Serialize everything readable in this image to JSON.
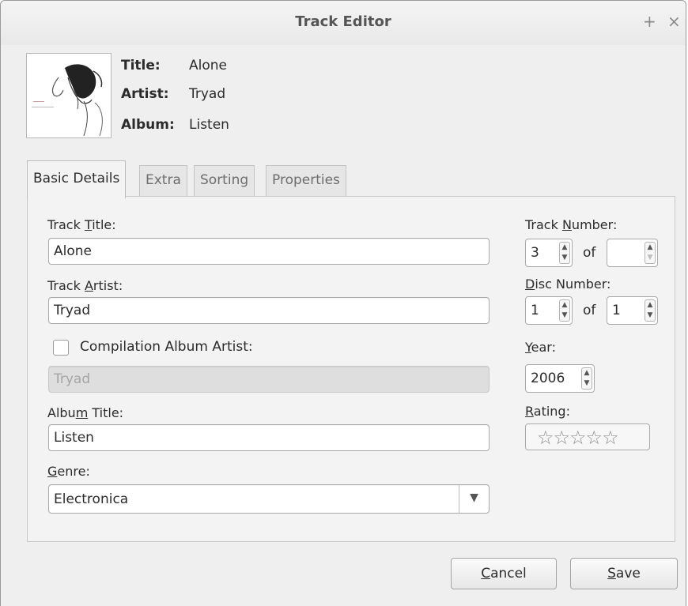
{
  "window": {
    "title": "Track Editor",
    "add_glyph": "+",
    "close_glyph": "×"
  },
  "header": {
    "cover_icon": "album-cover",
    "title_key": "Title:",
    "title_val": "Alone",
    "artist_key": "Artist:",
    "artist_val": "Tryad",
    "album_key": "Album:",
    "album_val": "Listen"
  },
  "tabs": [
    {
      "label": "Basic Details",
      "active": true
    },
    {
      "label": "Extra",
      "active": false
    },
    {
      "label": "Sorting",
      "active": false
    },
    {
      "label": "Properties",
      "active": false
    }
  ],
  "form": {
    "track_title_label_pre": "Track ",
    "track_title_label_u": "T",
    "track_title_label_post": "itle:",
    "track_title_value": "Alone",
    "track_artist_label_pre": "Track ",
    "track_artist_label_u": "A",
    "track_artist_label_post": "rtist:",
    "track_artist_value": "Tryad",
    "compilation_label": "Compilation Album Artist:",
    "compilation_checked": false,
    "compilation_value": "Tryad",
    "album_title_label_pre": "Albu",
    "album_title_label_u": "m",
    "album_title_label_post": " Title:",
    "album_title_value": "Listen",
    "genre_label_u": "G",
    "genre_label_post": "enre:",
    "genre_value": "Electronica",
    "track_number_label_pre": "Track ",
    "track_number_label_u": "N",
    "track_number_label_post": "umber:",
    "track_number": "3",
    "track_total": "",
    "disc_number_label_u": "D",
    "disc_number_label_post": "isc Number:",
    "disc_number": "1",
    "disc_total": "1",
    "of_text": "of",
    "year_label_u": "Y",
    "year_label_post": "ear:",
    "year": "2006",
    "rating_label_u": "R",
    "rating_label_post": "ating:",
    "rating_stars": "☆☆☆☆☆",
    "rating_value": 0
  },
  "buttons": {
    "cancel_u": "C",
    "cancel_post": "ancel",
    "save_u": "S",
    "save_post": "ave"
  }
}
